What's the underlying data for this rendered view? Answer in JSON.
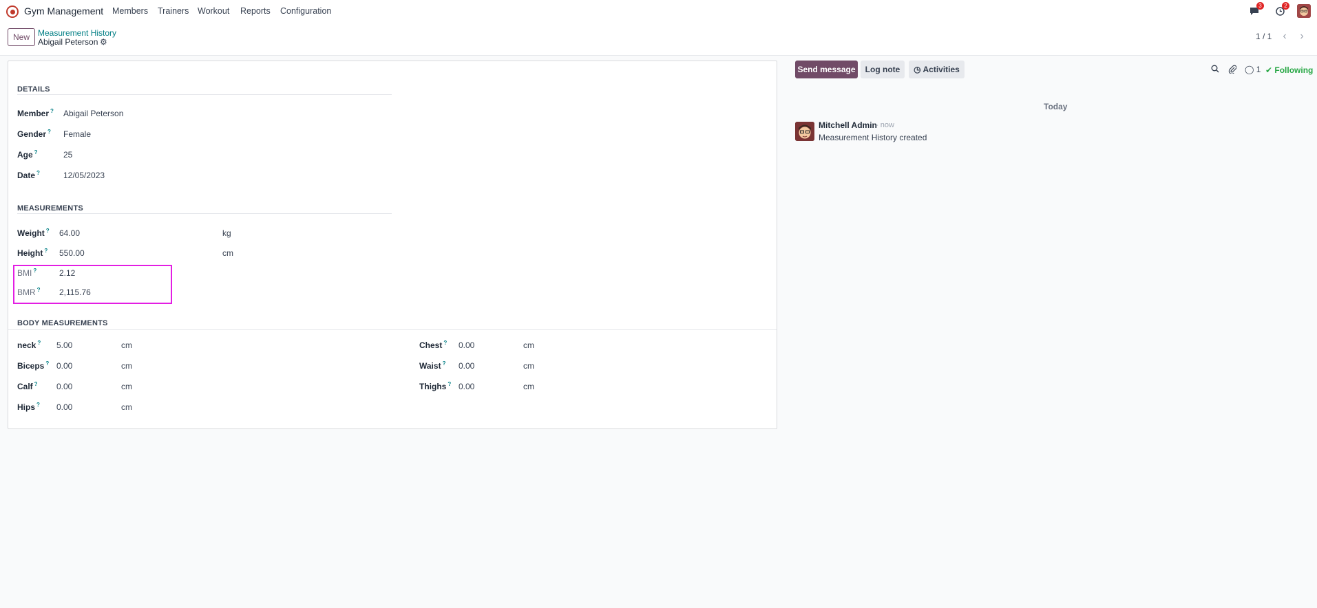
{
  "navbar": {
    "app_name": "Gym Management",
    "menu": [
      "Members",
      "Trainers",
      "Workout",
      "Reports",
      "Configuration"
    ],
    "messages_count": "3",
    "activities_count": "2"
  },
  "control_panel": {
    "new_label": "New",
    "breadcrumb": "Measurement History",
    "record_name": "Abigail Peterson",
    "pager": "1 / 1"
  },
  "form": {
    "details_title": "DETAILS",
    "details": [
      {
        "label": "Member",
        "value": "Abigail Peterson"
      },
      {
        "label": "Gender",
        "value": "Female"
      },
      {
        "label": "Age",
        "value": "25"
      },
      {
        "label": "Date",
        "value": "12/05/2023"
      }
    ],
    "measurements_title": "MEASUREMENTS",
    "measurements": [
      {
        "label": "Weight",
        "value": "64.00",
        "unit": "kg"
      },
      {
        "label": "Height",
        "value": "550.00",
        "unit": "cm"
      },
      {
        "label": "BMI",
        "value": "2.12",
        "unit": ""
      },
      {
        "label": "BMR",
        "value": "2,115.76",
        "unit": ""
      }
    ],
    "body_title": "BODY MEASUREMENTS",
    "body_left": [
      {
        "label": "neck",
        "value": "5.00",
        "unit": "cm"
      },
      {
        "label": "Biceps",
        "value": "0.00",
        "unit": "cm"
      },
      {
        "label": "Calf",
        "value": "0.00",
        "unit": "cm"
      },
      {
        "label": "Hips",
        "value": "0.00",
        "unit": "cm"
      }
    ],
    "body_right": [
      {
        "label": "Chest",
        "value": "0.00",
        "unit": "cm"
      },
      {
        "label": "Waist",
        "value": "0.00",
        "unit": "cm"
      },
      {
        "label": "Thighs",
        "value": "0.00",
        "unit": "cm"
      }
    ],
    "help_mark": "?"
  },
  "chatter": {
    "send_message": "Send message",
    "log_note": "Log note",
    "activities": "Activities",
    "followers_count": "1",
    "following": "Following",
    "date_separator": "Today",
    "message": {
      "author": "Mitchell Admin",
      "time": "- now",
      "body": "Measurement History created"
    }
  }
}
